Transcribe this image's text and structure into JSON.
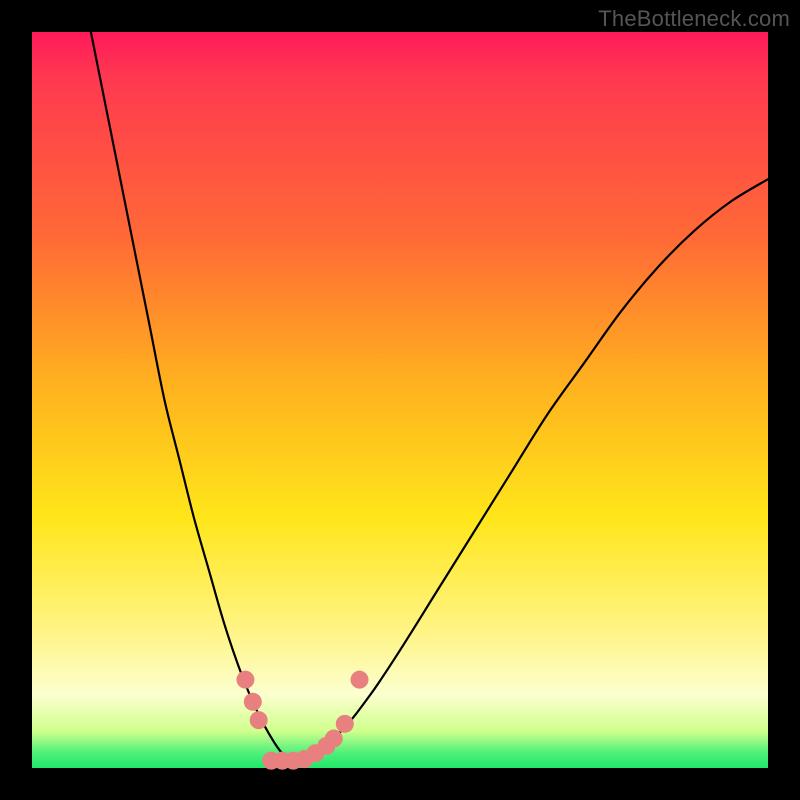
{
  "watermark": "TheBottleneck.com",
  "chart_data": {
    "type": "line",
    "title": "",
    "xlabel": "",
    "ylabel": "",
    "xlim": [
      0,
      100
    ],
    "ylim": [
      0,
      100
    ],
    "grid": false,
    "series": [
      {
        "name": "bottleneck-curve",
        "x": [
          8,
          10,
          12,
          14,
          16,
          18,
          20,
          22,
          24,
          26,
          28,
          30,
          32,
          34,
          36,
          38,
          42,
          46,
          50,
          55,
          60,
          65,
          70,
          75,
          80,
          85,
          90,
          95,
          100
        ],
        "values": [
          100,
          90,
          80,
          70,
          60,
          50,
          42,
          34,
          27,
          20,
          14,
          9,
          5,
          2,
          1,
          2,
          5,
          10,
          16,
          24,
          32,
          40,
          48,
          55,
          62,
          68,
          73,
          77,
          80
        ]
      }
    ],
    "markers": {
      "color": "#e88080",
      "radius_px": 9,
      "points": [
        {
          "x": 29.0,
          "y": 12.0
        },
        {
          "x": 30.0,
          "y": 9.0
        },
        {
          "x": 30.8,
          "y": 6.5
        },
        {
          "x": 32.5,
          "y": 1.0
        },
        {
          "x": 34.0,
          "y": 1.0
        },
        {
          "x": 35.5,
          "y": 1.0
        },
        {
          "x": 37.0,
          "y": 1.2
        },
        {
          "x": 38.5,
          "y": 2.0
        },
        {
          "x": 40.0,
          "y": 3.0
        },
        {
          "x": 41.0,
          "y": 4.0
        },
        {
          "x": 42.5,
          "y": 6.0
        },
        {
          "x": 44.5,
          "y": 12.0
        }
      ]
    },
    "gradient_stops": [
      {
        "pos": 0.0,
        "color": "#ff1a5a"
      },
      {
        "pos": 0.28,
        "color": "#ff6a36"
      },
      {
        "pos": 0.48,
        "color": "#ffb21e"
      },
      {
        "pos": 0.66,
        "color": "#ffe61a"
      },
      {
        "pos": 0.9,
        "color": "#fcffcf"
      },
      {
        "pos": 1.0,
        "color": "#1fe86a"
      }
    ]
  }
}
